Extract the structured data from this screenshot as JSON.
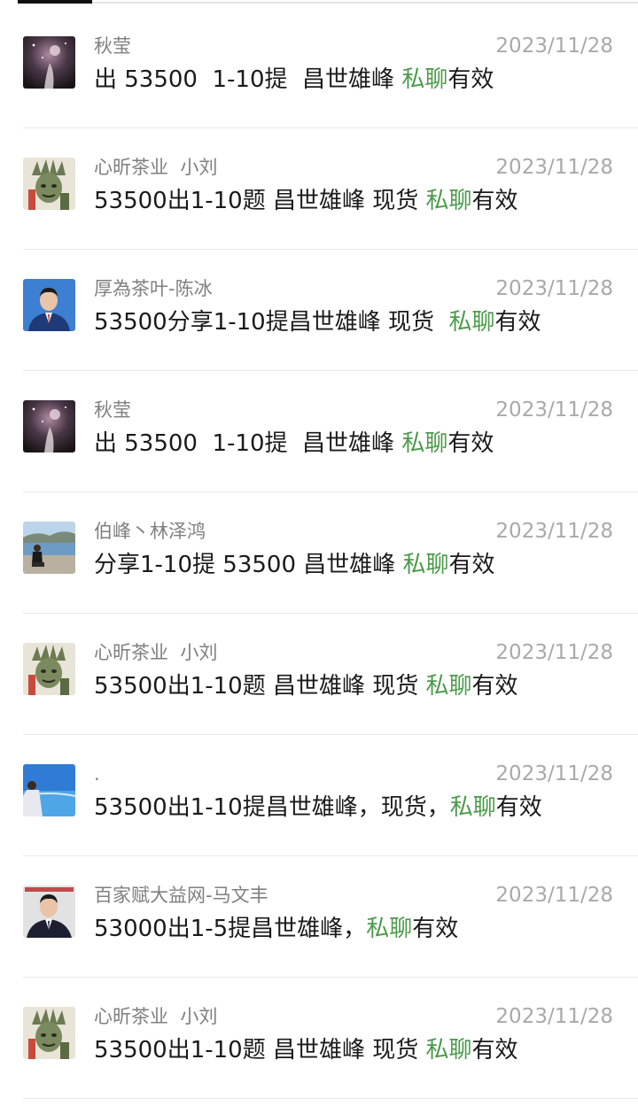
{
  "messages": [
    {
      "sender": "秋莹",
      "date": "2023/11/28",
      "text_before": "出 53500  1-10提  昌世雄峰 ",
      "highlight": "私聊",
      "text_after": "有效",
      "avatar": "night-sky-avatar"
    },
    {
      "sender": "心昕茶业  小刘",
      "date": "2023/11/28",
      "text_before": "53500出1-10题 昌世雄峰 现货 ",
      "highlight": "私聊",
      "text_after": "有效",
      "avatar": "statue-avatar"
    },
    {
      "sender": "厚為茶叶-陈冰",
      "date": "2023/11/28",
      "text_before": "53500分享1-10提昌世雄峰 现货  ",
      "highlight": "私聊",
      "text_after": "有效",
      "avatar": "man-suit-blue-avatar"
    },
    {
      "sender": "秋莹",
      "date": "2023/11/28",
      "text_before": "出 53500  1-10提  昌世雄峰 ",
      "highlight": "私聊",
      "text_after": "有效",
      "avatar": "night-sky-avatar"
    },
    {
      "sender": "伯峰丶林泽鸿",
      "date": "2023/11/28",
      "text_before": "分享1-10提 53500 昌世雄峰 ",
      "highlight": "私聊",
      "text_after": "有效",
      "avatar": "beach-person-avatar"
    },
    {
      "sender": "心昕茶业  小刘",
      "date": "2023/11/28",
      "text_before": "53500出1-10题 昌世雄峰 现货 ",
      "highlight": "私聊",
      "text_after": "有效",
      "avatar": "statue-avatar"
    },
    {
      "sender": ".",
      "date": "2023/11/28",
      "text_before": "53500出1-10提昌世雄峰，现货，",
      "highlight": "私聊",
      "text_after": "有效",
      "avatar": "seaside-avatar"
    },
    {
      "sender": "百家赋大益网-马文丰",
      "date": "2023/11/28",
      "text_before": "53000出1-5提昌世雄峰，",
      "highlight": "私聊",
      "text_after": "有效",
      "avatar": "man-suit-dark-avatar"
    },
    {
      "sender": "心昕茶业  小刘",
      "date": "2023/11/28",
      "text_before": "53500出1-10题 昌世雄峰 现货 ",
      "highlight": "私聊",
      "text_after": "有效",
      "avatar": "statue-avatar"
    }
  ],
  "colors": {
    "highlight": "#4a9a4a",
    "sender": "#7f7f7f",
    "date": "#a9a9a9",
    "text": "#1a1a1a"
  }
}
